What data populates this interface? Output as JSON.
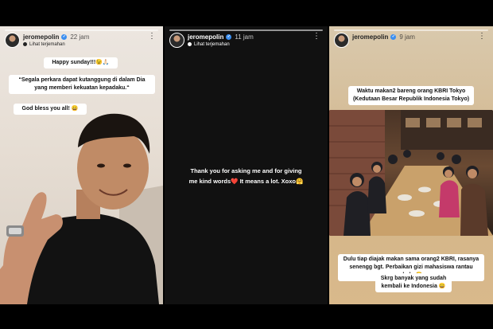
{
  "stories": [
    {
      "username": "jeromepolin",
      "time": "22 jam",
      "translate_label": "Lihat terjemahan",
      "stickers": {
        "happy": "Happy sunday!!!😉🙏🏻",
        "quote": "“Segala perkara dapat kutanggung di dalam Dia yang memberi kekuatan kepadaku.“",
        "bless": "God bless you all! 😄"
      }
    },
    {
      "username": "jeromepolin",
      "time": "11 jam",
      "translate_label": "Lihat terjemahan",
      "message_line1": "Thank you for asking me and for giving",
      "message_line2_a": "me kind words",
      "message_heart": "❤️",
      "message_line2_b": " It means a lot. Xoxo🤗"
    },
    {
      "username": "jeromepolin",
      "time": "9 jam",
      "stickers": {
        "title_line1": "Waktu makan2 bareng orang KBRI Tokyo",
        "title_line2": "(Kedutaan Besar Republik Indonesia Tokyo)",
        "story": "Dulu tiap diajak makan sama orang2 KBRI, rasanya senengg bgt. Perbaikan gizi mahasiswa rantau ahaha😂",
        "now": "Skrg banyak yang sudah kembali ke Indonesia 😄"
      }
    }
  ],
  "colors": {
    "verified": "#3b8ef0",
    "heart": "#e0262d"
  },
  "icons": {
    "verified": "verified-badge-icon",
    "more": "more-options-icon",
    "translate": "translate-icon"
  }
}
